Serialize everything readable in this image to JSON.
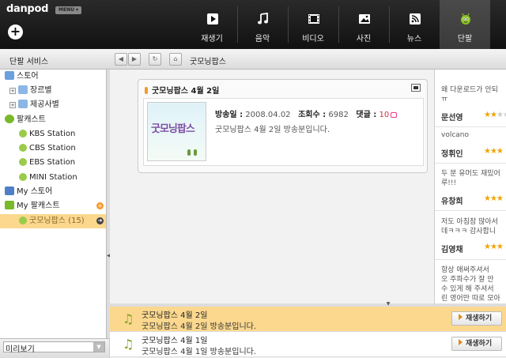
{
  "app": {
    "logo": "danpod",
    "menu_label": "MENU"
  },
  "nav": [
    {
      "label": "재생기",
      "icon": "play-icon"
    },
    {
      "label": "음악",
      "icon": "music-note-icon"
    },
    {
      "label": "비디오",
      "icon": "film-icon"
    },
    {
      "label": "사진",
      "icon": "photo-icon"
    },
    {
      "label": "뉴스",
      "icon": "rss-icon"
    },
    {
      "label": "단팔",
      "icon": "danpal-mascot-icon",
      "active": true
    }
  ],
  "sidebar": {
    "title": "단팔 서비스",
    "items": [
      {
        "label": "스토어",
        "icon": "store-icon",
        "level": 0
      },
      {
        "label": "장르별",
        "icon": "folder-icon",
        "level": 1,
        "expander": "+"
      },
      {
        "label": "제공사별",
        "icon": "folder-icon",
        "level": 1,
        "expander": "+"
      },
      {
        "label": "팔캐스트",
        "icon": "palcast-icon",
        "level": 0
      },
      {
        "label": "KBS Station",
        "icon": "station-icon",
        "level": 1
      },
      {
        "label": "CBS Station",
        "icon": "station-icon",
        "level": 1
      },
      {
        "label": "EBS Station",
        "icon": "station-icon",
        "level": 1
      },
      {
        "label": "MINI Station",
        "icon": "station-icon",
        "level": 1
      },
      {
        "label": "My 스토어",
        "icon": "my-store-icon",
        "level": 0
      },
      {
        "label": "My 팔캐스트",
        "icon": "my-palcast-icon",
        "level": 0
      },
      {
        "label": "굿모닝팝스 (15)",
        "icon": "station-icon",
        "level": 1,
        "selected": true
      }
    ],
    "preview_label": "미리보기"
  },
  "breadcrumb": "굿모닝팝스",
  "card": {
    "title": "굿모닝팝스 4월 2일",
    "thumb_text": "굿모닝팝스",
    "broadcast_label": "방송일 :",
    "broadcast_date": "2008.04.02",
    "views_label": "조회수 :",
    "views": "6982",
    "comments_label": "댓글 :",
    "comments": "10",
    "description": "굿모닝팝스 4월 2일 방송분입니다."
  },
  "comments": [
    {
      "text": "왜 다운로드가 안되",
      "name": "문선영",
      "stars": 2
    },
    {
      "text": "volcano",
      "name": "정휘인",
      "stars": 3
    },
    {
      "text": "두 분 유머도 재밌어",
      "text2": "루!!!",
      "name": "유창희",
      "stars": 3
    },
    {
      "text": "저도 아침잠 많아서",
      "text2": "데ㅋㅋㅋ 감사합니",
      "name": "김영채",
      "stars": 3
    },
    {
      "text": "항상 애써주셔서",
      "text2": "오 주파수가 잘 안",
      "text3": "수 있게 해 주셔서",
      "text4": "린 영어만 따로 모아"
    }
  ],
  "episodes": [
    {
      "title": "굿모닝팝스 4월 2일",
      "desc": "굿모닝팝스 4월 2일 방송분입니다.",
      "button": "재생하기"
    },
    {
      "title": "굿모닝팝스 4월 1일",
      "desc": "굿모닝팝스 4월 1일 방송분입니다.",
      "button": "재생하기"
    }
  ],
  "colors": {
    "topbar": "#1a1a1a",
    "selected": "#fbd88e",
    "accent": "#f59a2a",
    "star": "#f0a400"
  }
}
